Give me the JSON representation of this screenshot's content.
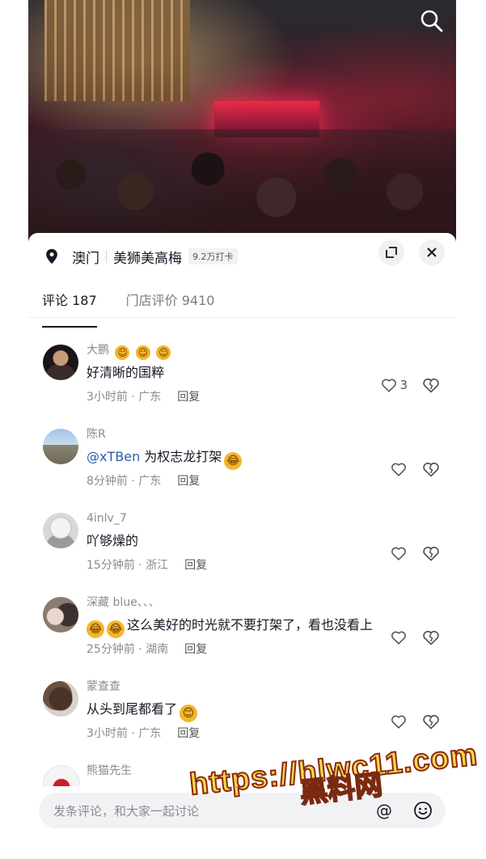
{
  "location": {
    "city": "澳门",
    "venue": "美狮美高梅",
    "checkins": "9.2万打卡"
  },
  "tabs": [
    {
      "label": "评论 187"
    },
    {
      "label": "门店评价 9410"
    }
  ],
  "comments": [
    {
      "user": "大鹏",
      "emojis": [
        "☺",
        "☺",
        "☺"
      ],
      "text": "好清晰的国粹",
      "mention": "",
      "text_emojis": [],
      "time": "3小时前 · 广东",
      "reply": "回复",
      "likes": "3"
    },
    {
      "user": "陈R",
      "emojis": [],
      "mention": "@xTBen",
      "text": " 为权志龙打架",
      "text_emojis": [
        "😂"
      ],
      "time": "8分钟前 · 广东",
      "reply": "回复",
      "likes": ""
    },
    {
      "user": "4inlv_7",
      "emojis": [],
      "mention": "",
      "text": "吖够燥的",
      "text_emojis": [],
      "time": "15分钟前 · 浙江",
      "reply": "回复",
      "likes": ""
    },
    {
      "user": "深藏 blue、、、",
      "emojis": [],
      "mention": "",
      "lead_emojis": [
        "😂",
        "😂"
      ],
      "text": "这么美好的时光就不要打架了，看也没看上",
      "text_emojis": [],
      "time": "25分钟前 · 湖南",
      "reply": "回复",
      "likes": ""
    },
    {
      "user": "蒙查查",
      "emojis": [],
      "mention": "",
      "text": "从头到尾都看了",
      "text_emojis": [
        "😊"
      ],
      "time": "3小时前 · 广东",
      "reply": "回复",
      "likes": ""
    },
    {
      "user": "熊猫先生"
    }
  ],
  "input": {
    "placeholder": "发条评论，和大家一起讨论"
  },
  "watermark": {
    "url": "https://hlwc11.com",
    "name": "黑料网"
  },
  "icons": {
    "search": "search-icon",
    "location": "location-pin-icon",
    "expand": "expand-icon",
    "close": "close-icon",
    "like": "heart-icon",
    "dislike": "broken-heart-icon",
    "at": "at-icon",
    "emoji": "emoji-icon"
  }
}
